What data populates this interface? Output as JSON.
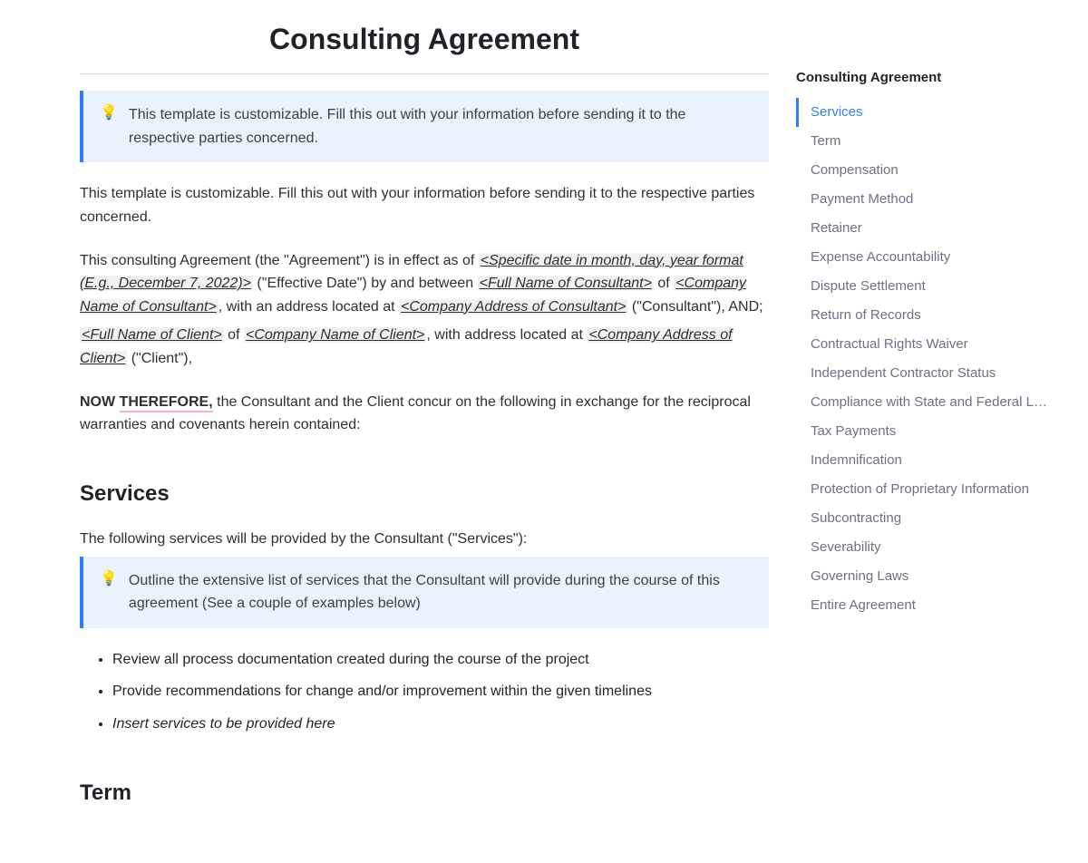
{
  "doc": {
    "title": "Consulting Agreement",
    "callout1": "This template is customizable. Fill this out with your information before sending it to the respective parties concerned.",
    "intro_repeat": "This template is customizable. Fill this out with your information before sending it to the respective parties concerned.",
    "p1_a": "This consulting Agreement (the \"Agreement\") is in effect as of ",
    "ph_date": "<Specific date in month, day, year format (E.g., December 7, 2022)>",
    "p1_b": " (\"Effective Date\") by and between ",
    "ph_consultant_name": "<Full Name of Consultant>",
    "p1_c": " of ",
    "ph_consultant_company": "<Company Name of Consultant>",
    "p1_d": ", with an address located at ",
    "ph_consultant_address": "<Company Address of Consultant>",
    "p1_e": " (\"Consultant\"), AND;",
    "ph_client_name": "<Full Name of Client>",
    "p2_a": " of ",
    "ph_client_company": "<Company Name of Client>",
    "p2_b": ", with address located at ",
    "ph_client_address": "<Company Address of Client>",
    "p2_c": " (\"Client\"),",
    "now": "NOW ",
    "therefore": "THEREFORE,",
    "now_rest": " the Consultant and the Client concur on the following in exchange for the reciprocal warranties and covenants herein contained:",
    "services_heading": "Services",
    "services_lead": "The following services will be provided by the Consultant (\"Services\"):",
    "callout2": "Outline the extensive list of services that the Consultant will provide during the course of this agreement (See a couple of examples below)",
    "bullets": {
      "b1": "Review all process documentation created during the course of the project",
      "b2": "Provide recommendations for change and/or improvement within the given timelines",
      "b3": "Insert services to be provided here"
    },
    "term_heading": "Term"
  },
  "toc": {
    "title": "Consulting Agreement",
    "items": {
      "i0": "Services",
      "i1": "Term",
      "i2": "Compensation",
      "i3": "Payment Method",
      "i4": "Retainer",
      "i5": "Expense Accountability",
      "i6": "Dispute Settlement",
      "i7": "Return of Records",
      "i8": "Contractual Rights Waiver",
      "i9": "Independent Contractor Status",
      "i10": "Compliance with State and Federal Li…",
      "i11": "Tax Payments",
      "i12": "Indemnification",
      "i13": "Protection of Proprietary Information",
      "i14": "Subcontracting",
      "i15": "Severability",
      "i16": "Governing Laws",
      "i17": "Entire Agreement"
    }
  }
}
